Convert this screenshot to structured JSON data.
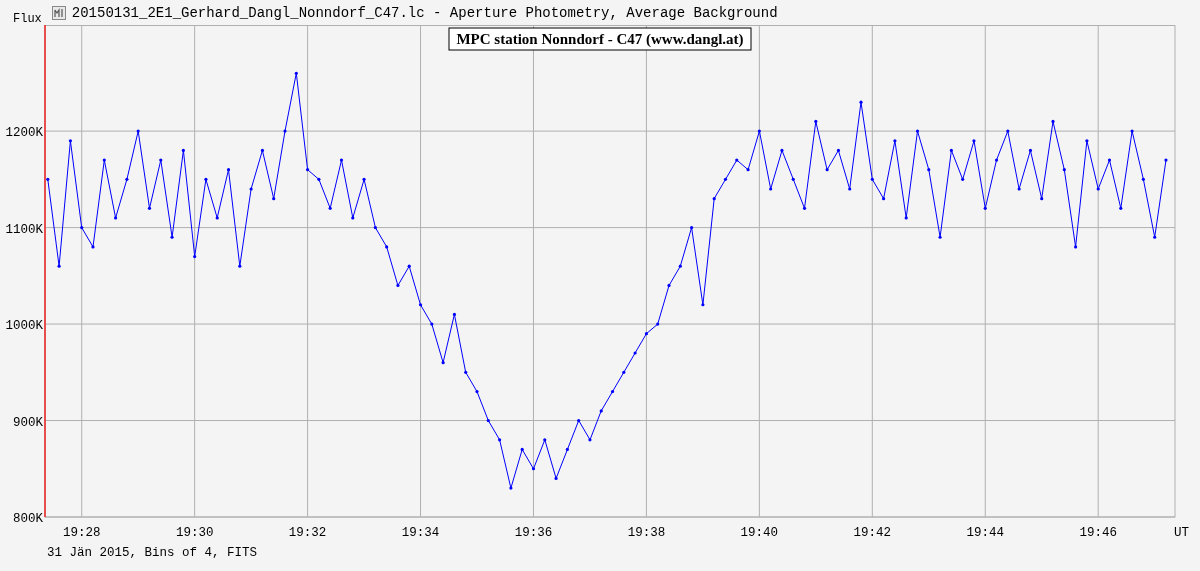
{
  "window": {
    "title": "20150131_2E1_Gerhard_Dangl_Nonndorf_C47.lc - Aperture Photometry, Average Background"
  },
  "chart": {
    "chart_data": {
      "type": "line",
      "title": "MPC station Nonndorf - C47 (www.dangl.at)",
      "ylabel": "Flux",
      "xlabel": "UT",
      "categories": [
        null,
        null,
        null,
        "19:28",
        null,
        null,
        null,
        null,
        null,
        null,
        null,
        null,
        null,
        "19:30",
        null,
        null,
        null,
        null,
        null,
        null,
        null,
        null,
        null,
        "19:32",
        null,
        null,
        null,
        null,
        null,
        null,
        null,
        null,
        null,
        "19:34",
        null,
        null,
        null,
        null,
        null,
        null,
        null,
        null,
        null,
        "19:36",
        null,
        null,
        null,
        null,
        null,
        null,
        null,
        null,
        null,
        "19:38",
        null,
        null,
        null,
        null,
        null,
        null,
        null,
        null,
        null,
        "19:40",
        null,
        null,
        null,
        null,
        null,
        null,
        null,
        null,
        null,
        "19:42",
        null,
        null,
        null,
        null,
        null,
        null,
        null,
        null,
        null,
        "19:44",
        null,
        null,
        null,
        null,
        null,
        null,
        null,
        null,
        null,
        "19:46",
        null,
        null,
        null,
        null,
        null,
        null
      ],
      "series": [
        {
          "color": "#0000ff",
          "values": [
            1150,
            1060,
            1190,
            1100,
            1080,
            1170,
            1110,
            1150,
            1200,
            1120,
            1170,
            1090,
            1180,
            1070,
            1150,
            1110,
            1160,
            1060,
            1140,
            1180,
            1130,
            1200,
            1260,
            1160,
            1150,
            1120,
            1170,
            1110,
            1150,
            1100,
            1080,
            1040,
            1060,
            1020,
            1000,
            960,
            1010,
            950,
            930,
            900,
            880,
            830,
            870,
            850,
            880,
            840,
            870,
            900,
            880,
            910,
            930,
            950,
            970,
            990,
            1000,
            1040,
            1060,
            1100,
            1020,
            1130,
            1150,
            1170,
            1160,
            1200,
            1140,
            1180,
            1150,
            1120,
            1210,
            1160,
            1180,
            1140,
            1230,
            1150,
            1130,
            1190,
            1110,
            1200,
            1160,
            1090,
            1180,
            1150,
            1190,
            1120,
            1170,
            1200,
            1140,
            1180,
            1130,
            1210,
            1160,
            1080,
            1190,
            1140,
            1170,
            1120,
            1200,
            1150,
            1090,
            1170
          ]
        }
      ],
      "ylim": [
        800,
        1310
      ],
      "grid": true,
      "yticks": [
        {
          "value": 800,
          "label": "800K"
        },
        {
          "value": 900,
          "label": "900K"
        },
        {
          "value": 1000,
          "label": "1000K"
        },
        {
          "value": 1100,
          "label": "1100K"
        },
        {
          "value": 1200,
          "label": "1200K"
        }
      ]
    }
  },
  "footer": "31 Jän 2015, Bins of 4, FITS"
}
